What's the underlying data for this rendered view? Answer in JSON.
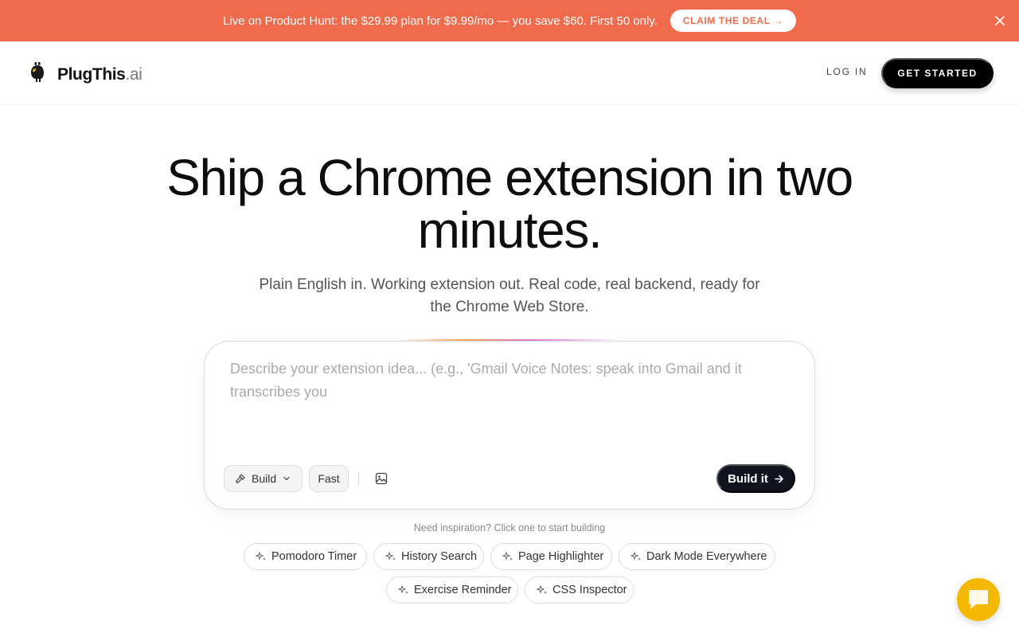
{
  "promo": {
    "text": "Live on Product Hunt: the $29.99 plan for $9.99/mo — you save $60. First 50 only.",
    "cta": "CLAIM THE DEAL →",
    "close_icon": "close-icon"
  },
  "nav": {
    "logo_name": "PlugThis",
    "logo_suffix": ".ai",
    "login": "LOG IN",
    "get_started": "GET STARTED"
  },
  "hero": {
    "title": "Ship a Chrome extension in two minutes.",
    "subtitle": "Plain English in. Working extension out. Real code, real backend, ready for the Chrome Web Store."
  },
  "prompt": {
    "placeholder": "Describe your extension idea... (e.g., 'Gmail Voice Notes: speak into Gmail and it transcribes you",
    "value": "",
    "mode_label": "Build",
    "speed_label": "Fast",
    "submit_label": "Build it"
  },
  "inspiration": {
    "heading": "Need inspiration? Click one to start building",
    "suggestions": [
      "Pomodoro Timer",
      "History Search",
      "Page Highlighter",
      "Dark Mode Everywhere",
      "Exercise Reminder",
      "CSS Inspector"
    ]
  },
  "colors": {
    "promo_bg": "#f06a4c",
    "primary_button": "#000000",
    "submit_button": "#11131f",
    "chat_button": "#f5b800"
  },
  "icons": [
    "logo-icon",
    "close-icon",
    "hammer-icon",
    "chevron-down-icon",
    "image-icon",
    "arrow-right-icon",
    "sparkle-icon",
    "chat-icon"
  ]
}
